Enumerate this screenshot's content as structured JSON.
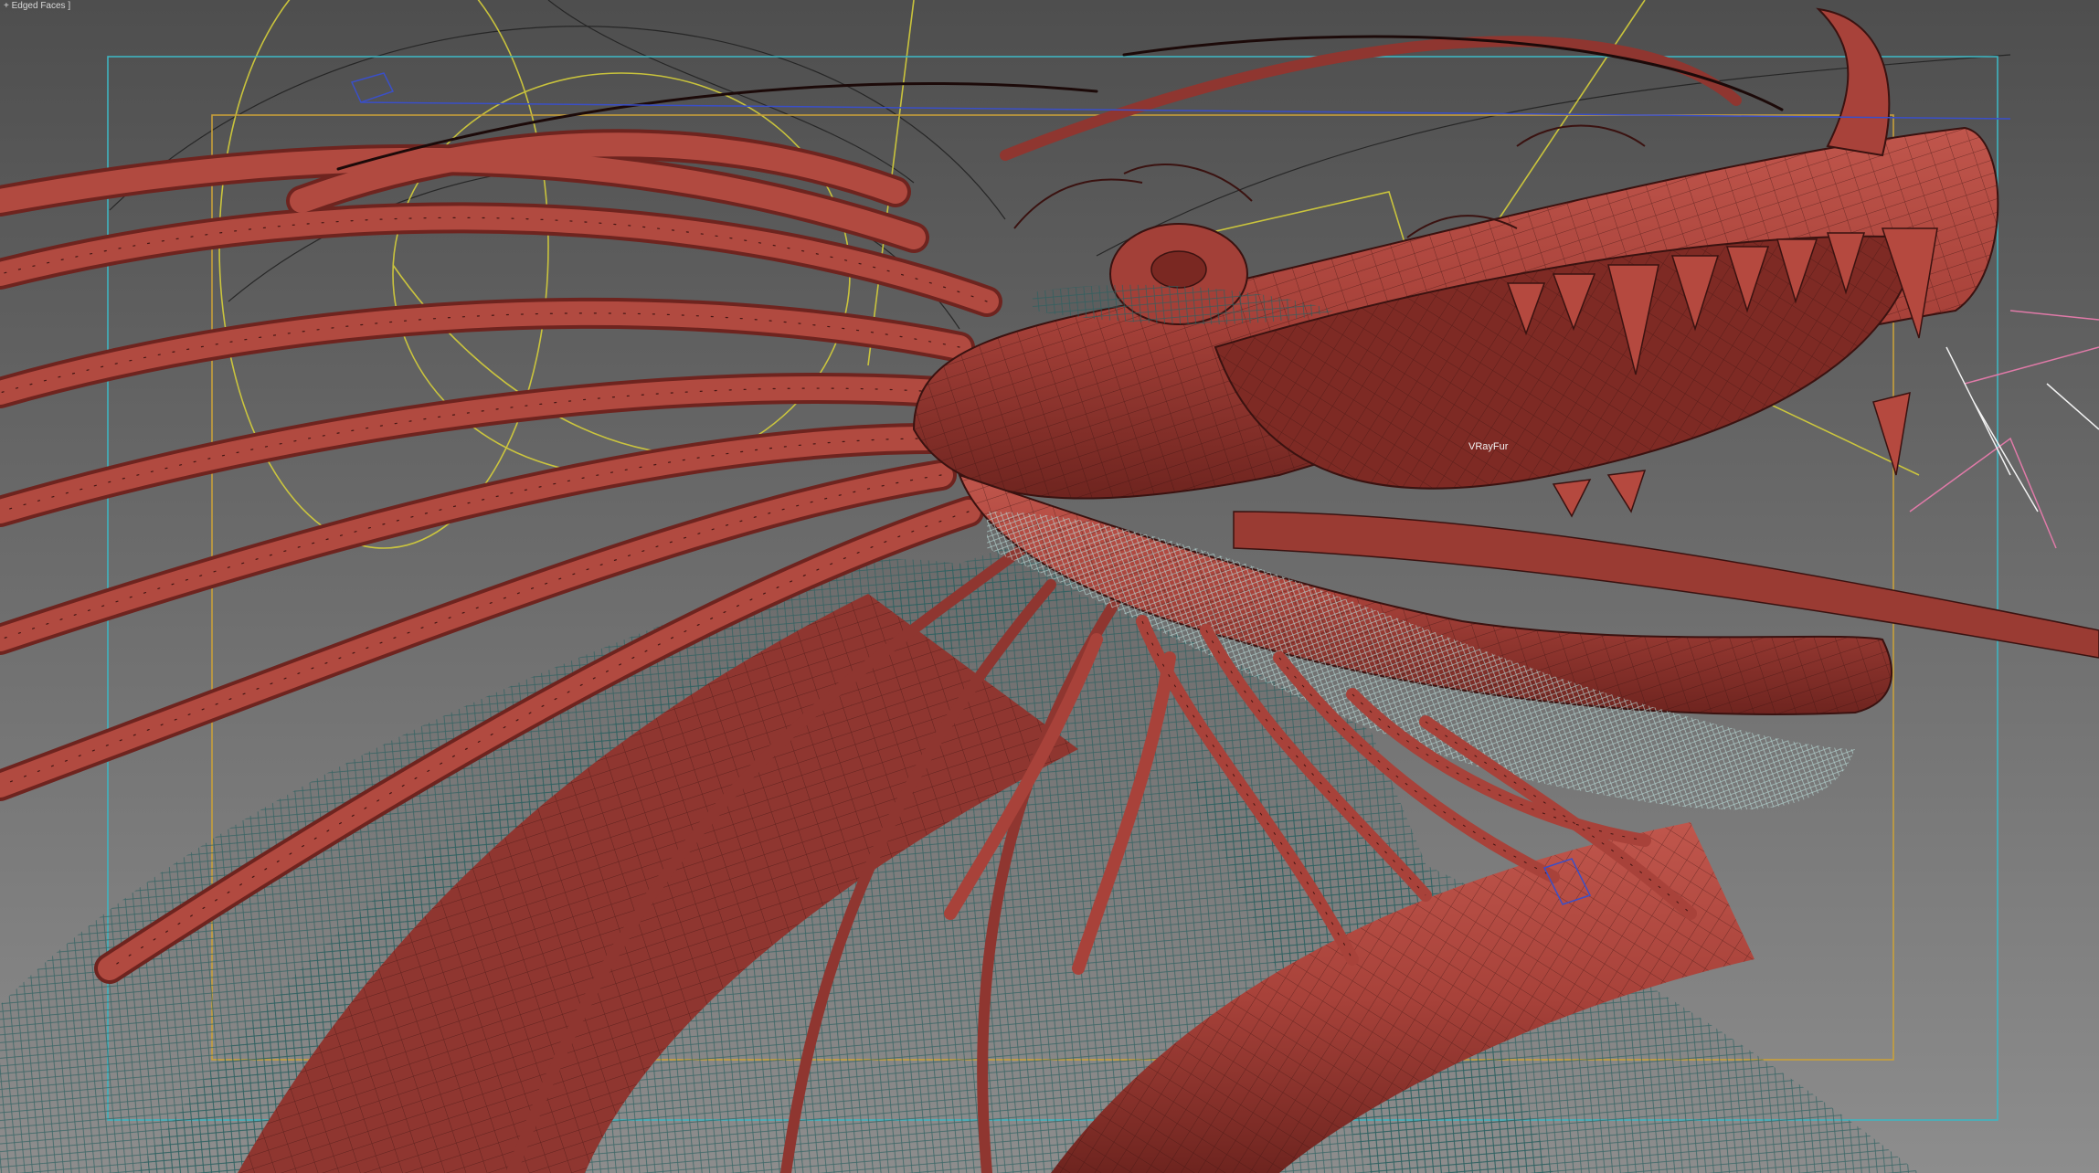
{
  "viewport": {
    "shading_label": "+ Edged Faces ]",
    "object_label": "VRayFur"
  },
  "colors": {
    "background_top": "#4e4e4e",
    "background_bottom": "#8d8d8d",
    "dragon_body": "#a8423a",
    "dragon_highlight": "#c0564c",
    "dragon_shadow": "#6e241f",
    "wire_edges": "#3a1210",
    "fur_wire": "#2a5f5f",
    "fur_light": "#b9dcd8",
    "safe_frame_outer": "#3fb4c0",
    "safe_frame_inner": "#c8a03a",
    "spline_yellow": "#d6cf3a",
    "camera_blue": "#3a4fc8"
  },
  "icons": {
    "camera": "camera-gizmo-icon"
  }
}
